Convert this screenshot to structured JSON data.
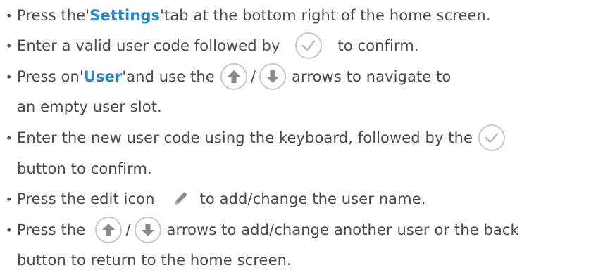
{
  "lines": {
    "l1": {
      "pre": "Press the ",
      "hl": "Settings",
      "post": " tab at the bottom right of the home screen."
    },
    "l2": {
      "pre": "Enter a valid user code followed by",
      "post": "to confirm."
    },
    "l3": {
      "pre": "Press on ",
      "hl": "User",
      "mid": " and use the",
      "slash": "/",
      "post": "arrows to navigate to"
    },
    "l4": {
      "text": "an empty user slot."
    },
    "l5": {
      "pre": "Enter the new user code using the keyboard, followed by the"
    },
    "l6": {
      "text": "button to confirm."
    },
    "l7": {
      "pre": "Press the edit icon",
      "post": "to add/change the user name."
    },
    "l8": {
      "pre": "Press the",
      "slash": "/",
      "post": "arrows to add/change another user or the back"
    },
    "l9": {
      "text": "button to return to the home screen."
    }
  },
  "bullet": "•",
  "quote_open": "'",
  "quote_close": "'",
  "colors": {
    "text": "#4b4b4b",
    "highlight": "#2b84c6",
    "icon_ring": "#c9c9c9",
    "check": "#b8b8b8",
    "arrow": "#8a8a8a",
    "pencil": "#8a8a8a"
  },
  "icons": {
    "confirm": "check-icon",
    "up": "arrow-up-icon",
    "down": "arrow-down-icon",
    "edit": "pencil-icon"
  }
}
